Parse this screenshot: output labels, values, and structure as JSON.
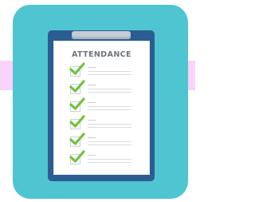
{
  "illustration": {
    "title": "ATTENDANCE",
    "rows": [
      {
        "checked": true
      },
      {
        "checked": true
      },
      {
        "checked": true
      },
      {
        "checked": true
      },
      {
        "checked": true
      },
      {
        "checked": true
      }
    ]
  },
  "colors": {
    "tile": "#4fc5d1",
    "board": "#2b5d93",
    "paper": "#ffffff",
    "clip": "#c2cdd4",
    "check": "#71c23c",
    "band": "#f9d3f9"
  },
  "icons": {
    "row_icon": "checkmark-icon",
    "clip_icon": "clipboard-clip-icon"
  }
}
